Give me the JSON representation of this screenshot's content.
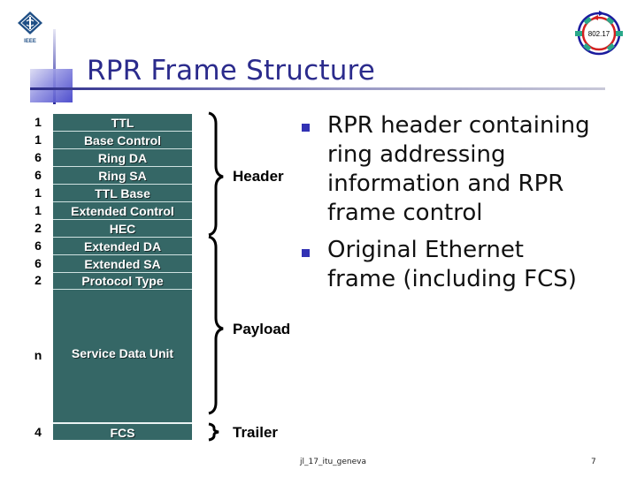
{
  "slide": {
    "title": "RPR Frame Structure",
    "logos": {
      "left": "ieee-logo",
      "left_caption": "IEEE",
      "right": "802-17-ring-logo",
      "right_caption": "802.17"
    },
    "colors": {
      "title": "#2b2b8c",
      "table_fill": "#356766",
      "bullet": "#3232b4"
    }
  },
  "frame": {
    "header_fields": [
      {
        "size": "1",
        "name": "TTL"
      },
      {
        "size": "1",
        "name": "Base Control"
      },
      {
        "size": "6",
        "name": "Ring DA"
      },
      {
        "size": "6",
        "name": "Ring SA"
      },
      {
        "size": "1",
        "name": "TTL Base"
      },
      {
        "size": "1",
        "name": "Extended Control"
      },
      {
        "size": "2",
        "name": "HEC"
      },
      {
        "size": "6",
        "name": "Extended DA"
      },
      {
        "size": "6",
        "name": "Extended SA"
      },
      {
        "size": "2",
        "name": "Protocol Type"
      }
    ],
    "payload": {
      "size": "n",
      "name": "Service Data Unit"
    },
    "trailer": {
      "size": "4",
      "name": "FCS"
    },
    "brace_labels": {
      "header": "Header",
      "payload": "Payload",
      "trailer": "Trailer"
    }
  },
  "bullets": [
    {
      "lines": [
        "RPR header containing",
        "ring addressing",
        "information and RPR",
        "frame control"
      ]
    },
    {
      "lines": [
        "Original Ethernet",
        "frame (including FCS)"
      ]
    }
  ],
  "footer": {
    "left": "jl_17_itu_geneva",
    "page": "7"
  }
}
